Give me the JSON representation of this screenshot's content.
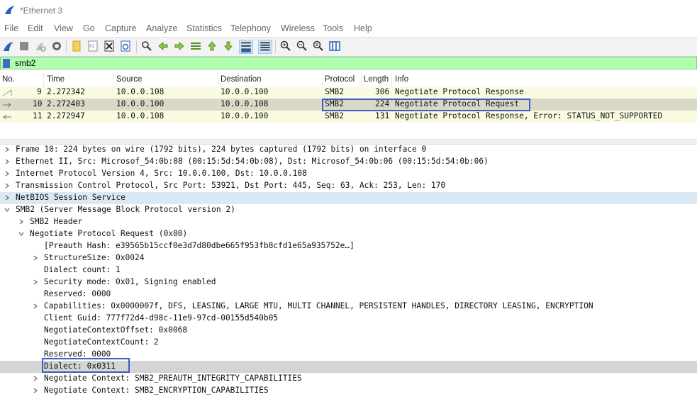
{
  "window": {
    "title": "*Ethernet 3"
  },
  "menu": [
    "File",
    "Edit",
    "View",
    "Go",
    "Capture",
    "Analyze",
    "Statistics",
    "Telephony",
    "Wireless",
    "Tools",
    "Help"
  ],
  "toolbar": {
    "icons": [
      "shark-fin-icon",
      "stop-icon",
      "restart-icon",
      "options-icon",
      "open-file-icon",
      "save-icon",
      "close-file-icon",
      "reload-icon",
      "find-icon",
      "back-icon",
      "forward-icon",
      "go-to-packet-icon",
      "first-packet-icon",
      "last-packet-icon",
      "autoscroll-icon",
      "colorize-icon",
      "zoom-in-icon",
      "zoom-out-icon",
      "normal-size-icon",
      "resize-columns-icon"
    ]
  },
  "filter": {
    "value": "smb2"
  },
  "packet_list": {
    "columns": [
      "No.",
      "Time",
      "Source",
      "Destination",
      "Protocol",
      "Length",
      "Info"
    ],
    "rows": [
      {
        "no": "9",
        "time": "2.272342",
        "src": "10.0.0.108",
        "dst": "10.0.0.100",
        "proto": "SMB2",
        "len": "306",
        "info": "Negotiate Protocol Response",
        "selected": false
      },
      {
        "no": "10",
        "time": "2.272403",
        "src": "10.0.0.100",
        "dst": "10.0.0.108",
        "proto": "SMB2",
        "len": "224",
        "info": "Negotiate Protocol Request",
        "selected": true
      },
      {
        "no": "11",
        "time": "2.272947",
        "src": "10.0.0.108",
        "dst": "10.0.0.100",
        "proto": "SMB2",
        "len": "131",
        "info": "Negotiate Protocol Response, Error: STATUS_NOT_SUPPORTED",
        "selected": false
      }
    ]
  },
  "details": [
    {
      "level": 0,
      "chev": "right",
      "text": "Frame 10: 224 bytes on wire (1792 bits), 224 bytes captured (1792 bits) on interface 0"
    },
    {
      "level": 0,
      "chev": "right",
      "text": "Ethernet II, Src: Microsof_54:0b:08 (00:15:5d:54:0b:08), Dst: Microsof_54:0b:06 (00:15:5d:54:0b:06)"
    },
    {
      "level": 0,
      "chev": "right",
      "text": "Internet Protocol Version 4, Src: 10.0.0.100, Dst: 10.0.0.108"
    },
    {
      "level": 0,
      "chev": "right",
      "text": "Transmission Control Protocol, Src Port: 53921, Dst Port: 445, Seq: 63, Ack: 253, Len: 170"
    },
    {
      "level": 0,
      "chev": "right",
      "text": "NetBIOS Session Service",
      "blue": true
    },
    {
      "level": 0,
      "chev": "down",
      "text": "SMB2 (Server Message Block Protocol version 2)"
    },
    {
      "level": 1,
      "chev": "right",
      "text": "SMB2 Header"
    },
    {
      "level": 1,
      "chev": "down",
      "text": "Negotiate Protocol Request (0x00)"
    },
    {
      "level": 2,
      "chev": "none",
      "text": "[Preauth Hash: e39565b15ccf0e3d7d80dbe665f953fb8cfd1e65a935752e…]"
    },
    {
      "level": 2,
      "chev": "right",
      "text": "StructureSize: 0x0024"
    },
    {
      "level": 2,
      "chev": "none",
      "text": "Dialect count: 1"
    },
    {
      "level": 2,
      "chev": "right",
      "text": "Security mode: 0x01, Signing enabled"
    },
    {
      "level": 2,
      "chev": "none",
      "text": "Reserved: 0000"
    },
    {
      "level": 2,
      "chev": "right",
      "text": "Capabilities: 0x0000007f, DFS, LEASING, LARGE MTU, MULTI CHANNEL, PERSISTENT HANDLES, DIRECTORY LEASING, ENCRYPTION"
    },
    {
      "level": 2,
      "chev": "none",
      "text": "Client Guid: 777f72d4-d98c-11e9-97cd-00155d540b05"
    },
    {
      "level": 2,
      "chev": "none",
      "text": "NegotiateContextOffset: 0x0068"
    },
    {
      "level": 2,
      "chev": "none",
      "text": "NegotiateContextCount: 2"
    },
    {
      "level": 2,
      "chev": "none",
      "text": "Reserved: 0000"
    },
    {
      "level": 2,
      "chev": "none",
      "text": "Dialect: 0x0311",
      "selected": true
    },
    {
      "level": 2,
      "chev": "right",
      "text": "Negotiate Context: SMB2_PREAUTH_INTEGRITY_CAPABILITIES"
    },
    {
      "level": 2,
      "chev": "right",
      "text": "Negotiate Context: SMB2_ENCRYPTION_CAPABILITIES"
    }
  ],
  "colors": {
    "filter_bg": "#afffaf",
    "highlight_border": "#3d5cc6",
    "row_bg": "#fbfbe1"
  }
}
